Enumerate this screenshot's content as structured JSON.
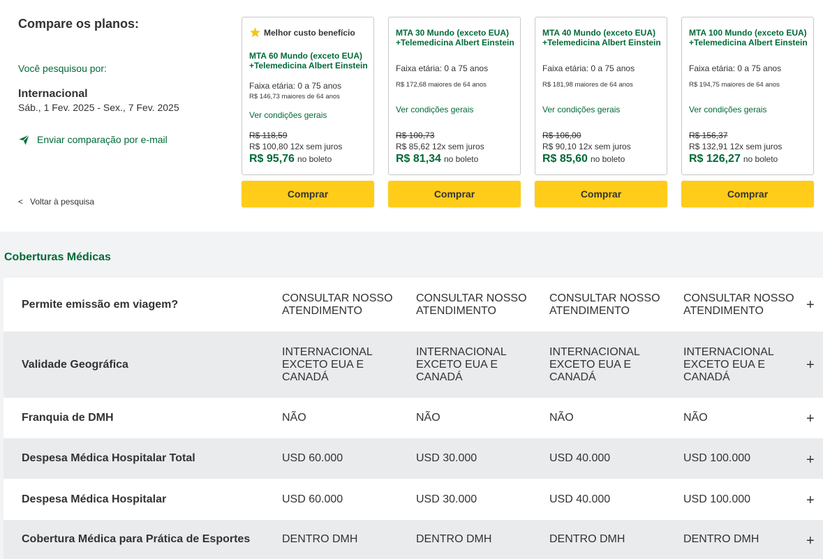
{
  "header": {
    "title": "Compare os planos:",
    "search_label": "Você pesquisou por:",
    "destination": "Internacional",
    "dates": "Sáb., 1 Fev. 2025 - Sex., 7 Fev. 2025",
    "email_label": "Enviar comparação por e-mail",
    "back_chevron": "<",
    "back_label": "Voltar à pesquisa"
  },
  "plans": [
    {
      "badge": "Melhor custo benefício",
      "name": "MTA 60 Mundo (exceto EUA) +Telemedicina Albert Einstein",
      "age": "Faixa etária: 0 a 75 anos",
      "over64": "R$ 146,73 maiores de 64 anos",
      "conditions": "Ver condições gerais",
      "old_price": "R$ 118,59",
      "installments": "R$ 100,80 12x sem juros",
      "price": "R$ 95,76",
      "price_suffix": "no boleto",
      "buy_label": "Comprar"
    },
    {
      "badge": "",
      "name": "MTA 30 Mundo (exceto EUA) +Telemedicina Albert Einstein",
      "age": "Faixa etária: 0 a 75 anos",
      "over64": "R$ 172,68 maiores de 64 anos",
      "conditions": "Ver condições gerais",
      "old_price": "R$ 100,73",
      "installments": "R$ 85,62 12x sem juros",
      "price": "R$ 81,34",
      "price_suffix": "no boleto",
      "buy_label": "Comprar"
    },
    {
      "badge": "",
      "name": "MTA 40 Mundo (exceto EUA) +Telemedicina Albert Einstein",
      "age": "Faixa etária: 0 a 75 anos",
      "over64": "R$ 181,98 maiores de 64 anos",
      "conditions": "Ver condições gerais",
      "old_price": "R$ 106,00",
      "installments": "R$ 90,10 12x sem juros",
      "price": "R$ 85,60",
      "price_suffix": "no boleto",
      "buy_label": "Comprar"
    },
    {
      "badge": "",
      "name": "MTA 100 Mundo (exceto EUA) +Telemedicina Albert Einstein",
      "age": "Faixa etária: 0 a 75 anos",
      "over64": "R$ 194,75 maiores de 64 anos",
      "conditions": "Ver condições gerais",
      "old_price": "R$ 156,37",
      "installments": "R$ 132,91 12x sem juros",
      "price": "R$ 126,27",
      "price_suffix": "no boleto",
      "buy_label": "Comprar"
    }
  ],
  "coverage": {
    "title": "Coberturas Médicas",
    "expand_symbol": "+",
    "rows": [
      {
        "label": "Permite emissão em viagem?",
        "values": [
          "CONSULTAR NOSSO ATENDIMENTO",
          "CONSULTAR NOSSO ATENDIMENTO",
          "CONSULTAR NOSSO ATENDIMENTO",
          "CONSULTAR NOSSO ATENDIMENTO"
        ]
      },
      {
        "label": "Validade Geográfica",
        "values": [
          "INTERNACIONAL EXCETO EUA E CANADÁ",
          "INTERNACIONAL EXCETO EUA E CANADÁ",
          "INTERNACIONAL EXCETO EUA E CANADÁ",
          "INTERNACIONAL EXCETO EUA E CANADÁ"
        ]
      },
      {
        "label": "Franquia de DMH",
        "values": [
          "NÃO",
          "NÃO",
          "NÃO",
          "NÃO"
        ]
      },
      {
        "label": "Despesa Médica Hospitalar Total",
        "values": [
          "USD 60.000",
          "USD 30.000",
          "USD 40.000",
          "USD 100.000"
        ]
      },
      {
        "label": "Despesa Médica Hospitalar",
        "values": [
          "USD 60.000",
          "USD 30.000",
          "USD 40.000",
          "USD 100.000"
        ]
      },
      {
        "label": "Cobertura Médica para Prática de Esportes",
        "values": [
          "DENTRO DMH",
          "DENTRO DMH",
          "DENTRO DMH",
          "DENTRO DMH"
        ]
      }
    ]
  },
  "colors": {
    "brand_green": "#006a37",
    "buy_yellow": "#ffcc1a",
    "star_yellow": "#f5c518"
  },
  "icons": {
    "email": "paper-plane-icon",
    "badge": "star-icon"
  }
}
